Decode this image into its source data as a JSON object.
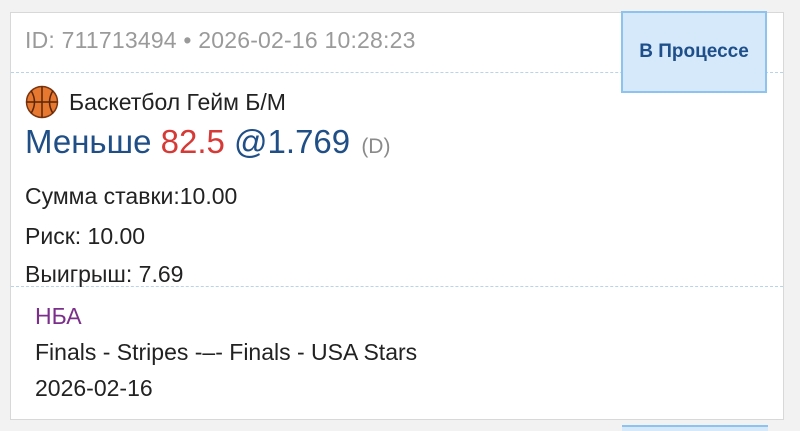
{
  "bet": {
    "id_line": "ID: 711713494 • 2026-02-16 10:28:23",
    "status": "В Процессе",
    "sport_icon": "basketball-icon",
    "market": "Баскетбол Гейм Б/М",
    "selection": {
      "pick": "Меньше",
      "line": "82.5",
      "odds": "@1.769",
      "odds_format": "(D)"
    },
    "stake_line": "Сумма ставки:10.00",
    "risk_line": "Риск: 10.00",
    "win_line": "Выигрыш: 7.69"
  },
  "event": {
    "league": "НБА",
    "name": "Finals - Stripes -–- Finals - USA Stars",
    "date": "2026-02-16"
  },
  "colors": {
    "status_bg": "#d5e9fb",
    "status_border": "#8cc3ef",
    "status_text": "#1f4f8a",
    "pick_text": "#1f4f86",
    "line_text": "#d63a36",
    "league_text": "#7b2f8b",
    "divider": "#b9d3ea"
  }
}
